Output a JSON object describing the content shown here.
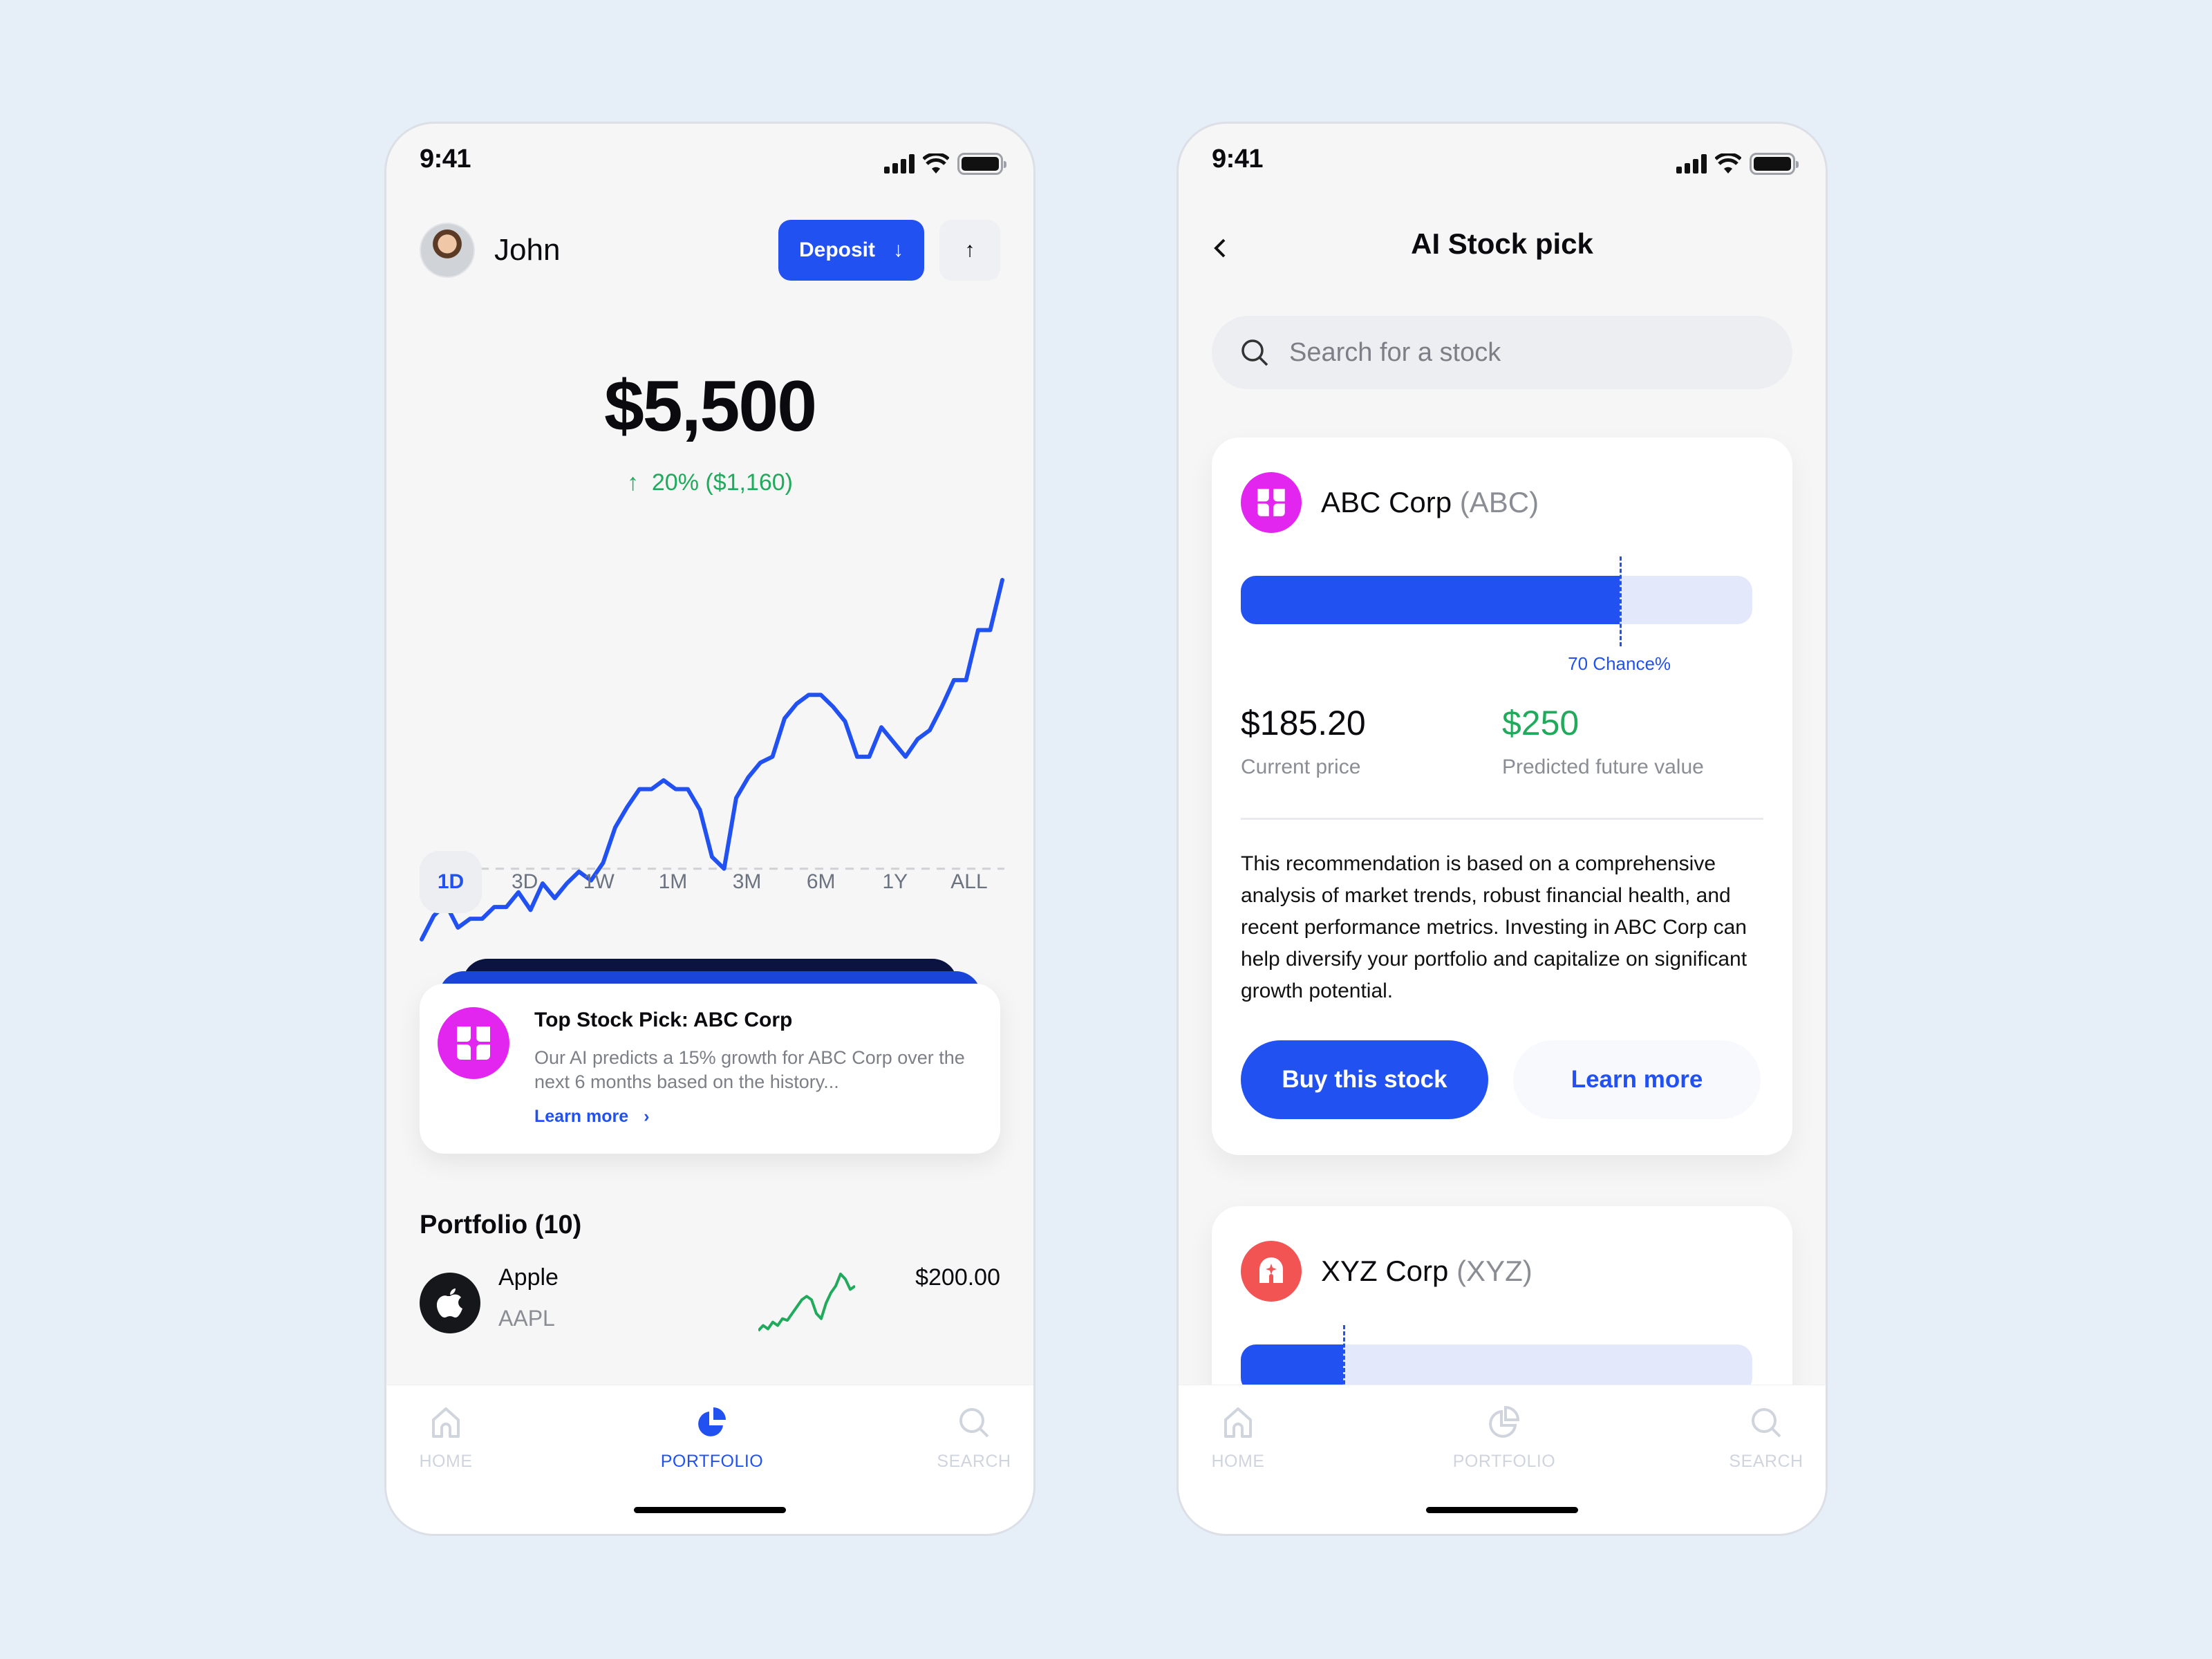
{
  "left": {
    "status": {
      "time": "9:41"
    },
    "header": {
      "user_name": "John",
      "deposit_label": "Deposit",
      "deposit_icon": "arrow-down-icon",
      "withdraw_icon": "arrow-up-icon"
    },
    "balance": "$5,500",
    "change": {
      "arrow": "↑",
      "text": "20% ($1,160)"
    },
    "chart_data": {
      "type": "line",
      "title": "",
      "baseline_dashed": true,
      "values": [
        10,
        18,
        22,
        14,
        17,
        17,
        21,
        21,
        26,
        20,
        29,
        24,
        29,
        33,
        30,
        36,
        48,
        55,
        61,
        61,
        64,
        61,
        61,
        54,
        38,
        34,
        58,
        65,
        70,
        72,
        85,
        90,
        93,
        93,
        89,
        84,
        72,
        72,
        82,
        77,
        72,
        78,
        81,
        89,
        98,
        98,
        115,
        115,
        132
      ]
    },
    "ranges": [
      "1D",
      "3D",
      "1W",
      "1M",
      "3M",
      "6M",
      "1Y",
      "ALL"
    ],
    "active_range": "1D",
    "pick": {
      "title": "Top Stock Pick: ABC Corp",
      "desc": "Our AI predicts a 15% growth for ABC Corp over the next 6 months based on the history...",
      "link": "Learn more",
      "link_icon": "›"
    },
    "portfolio": {
      "title": "Portfolio (10)",
      "holdings": [
        {
          "name": "Apple",
          "ticker": "AAPL",
          "price": "$200.00",
          "spark": [
            2,
            5,
            3,
            7,
            5,
            9,
            8,
            12,
            16,
            20,
            22,
            20,
            12,
            9,
            18,
            24,
            28,
            35,
            32,
            26,
            28
          ]
        }
      ]
    },
    "tabs": [
      {
        "label": "HOME",
        "icon": "home-icon"
      },
      {
        "label": "PORTFOLIO",
        "icon": "pie-chart-icon"
      },
      {
        "label": "SEARCH",
        "icon": "search-icon"
      }
    ],
    "active_tab": "PORTFOLIO"
  },
  "right": {
    "status": {
      "time": "9:41"
    },
    "title": "AI Stock pick",
    "search_placeholder": "Search for a stock",
    "stocks": [
      {
        "name": "ABC Corp",
        "ticker": "(ABC)",
        "color": "#e326ef",
        "chance": 0.74,
        "chance_label": "70 Chance%",
        "current_price": "$185.20",
        "current_label": "Current price",
        "future_value": "$250",
        "future_label": "Predicted future value",
        "description": "This recommendation is based on a comprehensive analysis of market trends, robust financial health, and recent performance metrics. Investing in ABC Corp can help diversify your portfolio and capitalize on significant growth potential.",
        "buy_label": "Buy this stock",
        "learn_label": "Learn more"
      },
      {
        "name": "XYZ Corp",
        "ticker": "(XYZ)",
        "color": "#f25454",
        "chance": 0.2
      }
    ],
    "tabs": [
      {
        "label": "HOME",
        "icon": "home-icon"
      },
      {
        "label": "PORTFOLIO",
        "icon": "pie-chart-icon"
      },
      {
        "label": "SEARCH",
        "icon": "search-icon"
      }
    ]
  },
  "colors": {
    "accent": "#2251f2",
    "positive": "#1faa5c",
    "abc_brand": "#e326ef",
    "xyz_brand": "#f25454"
  }
}
